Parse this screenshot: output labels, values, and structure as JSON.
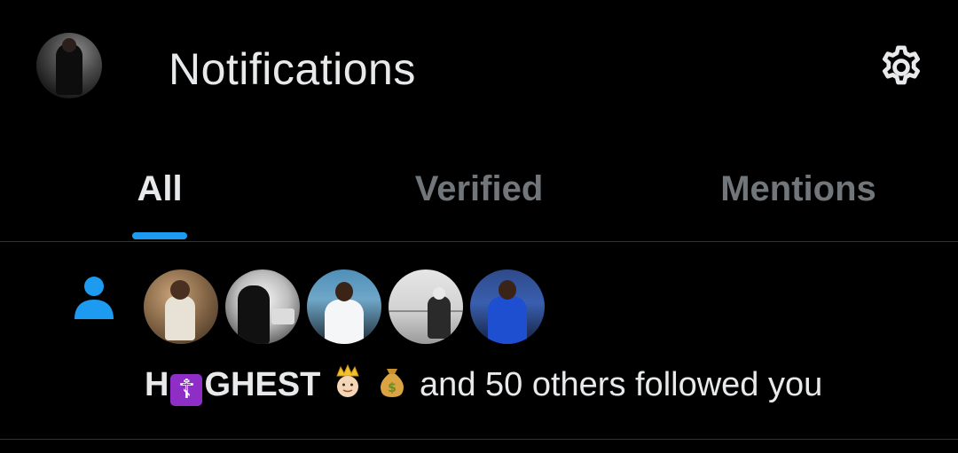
{
  "header": {
    "title": "Notifications",
    "avatar_icon": "profile-avatar",
    "settings_icon": "gear-icon"
  },
  "tabs": [
    {
      "label": "All",
      "active": true
    },
    {
      "label": "Verified",
      "active": false
    },
    {
      "label": "Mentions",
      "active": false
    }
  ],
  "notification": {
    "type_icon": "person-icon",
    "follower_count_shown": 5,
    "name_part1": "H",
    "name_cross": "☦",
    "name_part2": "GHEST",
    "emojis": [
      "crown-face-emoji",
      "money-bag-emoji"
    ],
    "message": "and 50 others followed you"
  },
  "colors": {
    "background": "#000000",
    "text_primary": "#e7e9ea",
    "text_secondary": "#71767b",
    "accent": "#1d9bf0",
    "divider": "#2f3336",
    "cross_box": "#8e2ec7"
  }
}
